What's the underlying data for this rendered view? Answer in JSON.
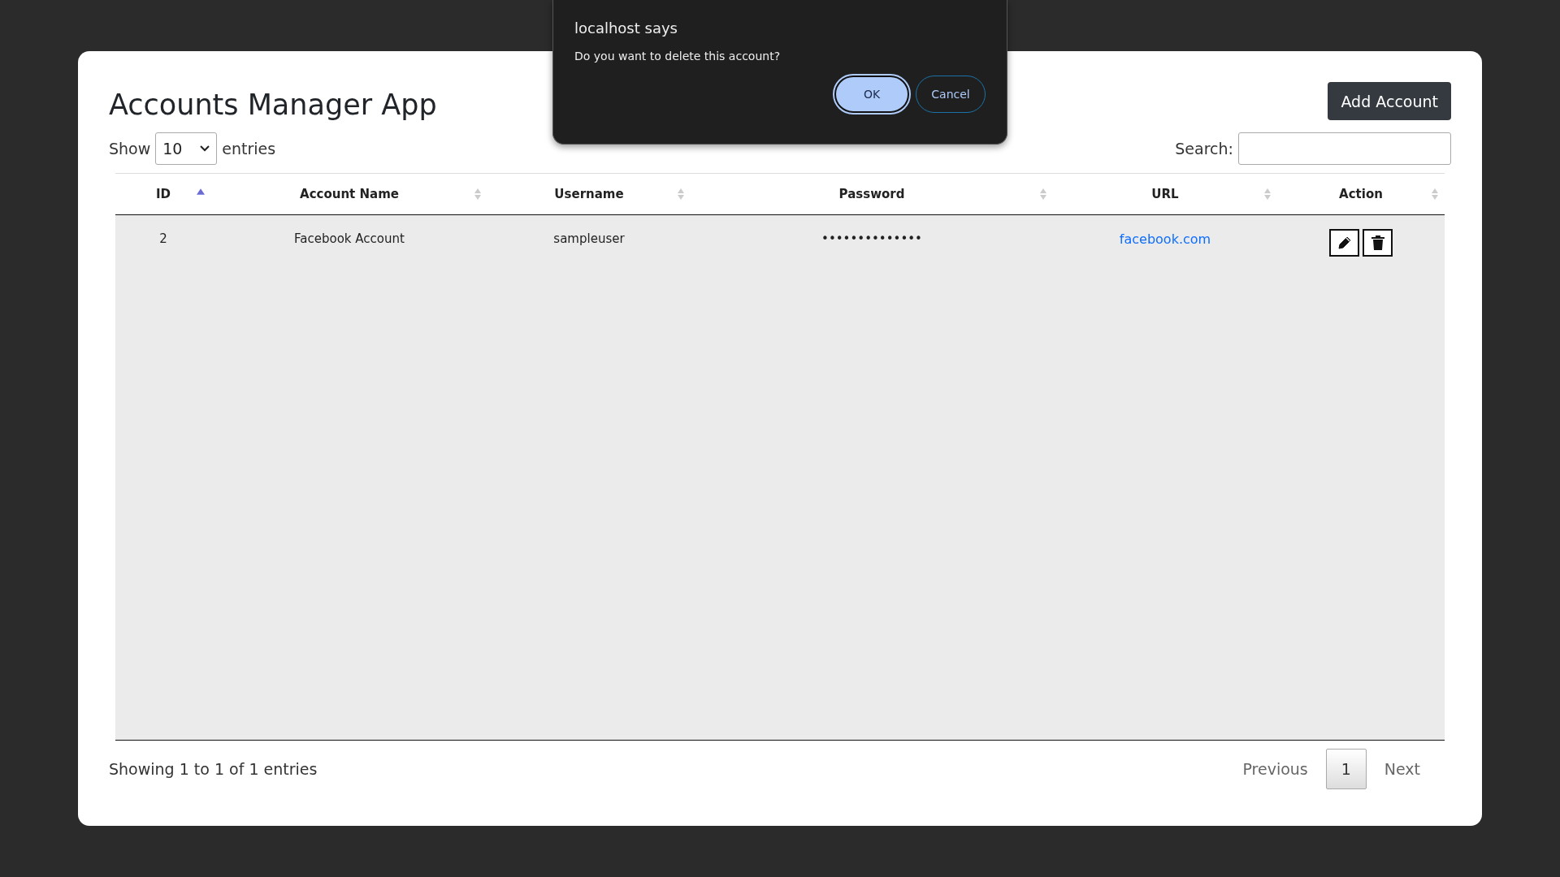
{
  "dialog": {
    "title": "localhost says",
    "message": "Do you want to delete this account?",
    "buttons": [
      {
        "label": "OK",
        "kind": "primary"
      },
      {
        "label": "Cancel",
        "kind": "secondary"
      }
    ]
  },
  "app": {
    "title": "Accounts Manager App",
    "add_button": "Add Account"
  },
  "length_control": {
    "before": "Show",
    "value": "10",
    "after": "entries"
  },
  "search": {
    "label": "Search:"
  },
  "table": {
    "columns": [
      {
        "label": "ID",
        "sorted": true
      },
      {
        "label": "Account Name",
        "sorted": false
      },
      {
        "label": "Username",
        "sorted": false
      },
      {
        "label": "Password",
        "sorted": false
      },
      {
        "label": "URL",
        "sorted": false
      },
      {
        "label": "Action",
        "sorted": false
      }
    ],
    "rows": [
      {
        "id": "2",
        "account_name": "Facebook Account",
        "username": "sampleuser",
        "password": "••••••••••••••",
        "url": "facebook.com"
      }
    ]
  },
  "footer": {
    "info": "Showing 1 to 1 of 1 entries",
    "previous": "Previous",
    "pages": [
      {
        "label": "1",
        "selected": true
      }
    ],
    "next": "Next"
  }
}
